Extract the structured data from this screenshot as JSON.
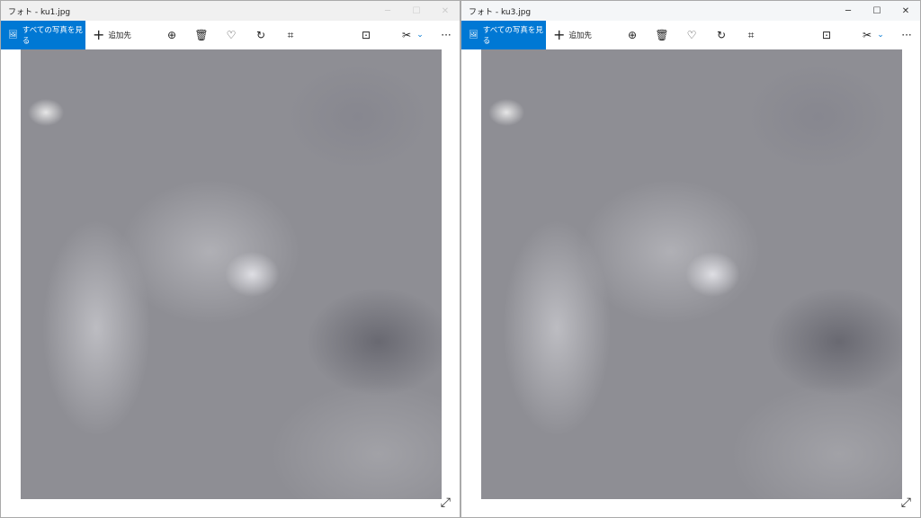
{
  "windows": [
    {
      "title": "フォト - ku1.jpg",
      "active": false
    },
    {
      "title": "フォト - ku3.jpg",
      "active": true
    }
  ],
  "toolbar": {
    "see_all": "すべての写真を見る",
    "add_to": "追加先",
    "more": "···"
  },
  "controls": {
    "minimize": "─",
    "maximize": "☐",
    "close": "✕"
  },
  "colors": {
    "accent": "#0078d4"
  }
}
